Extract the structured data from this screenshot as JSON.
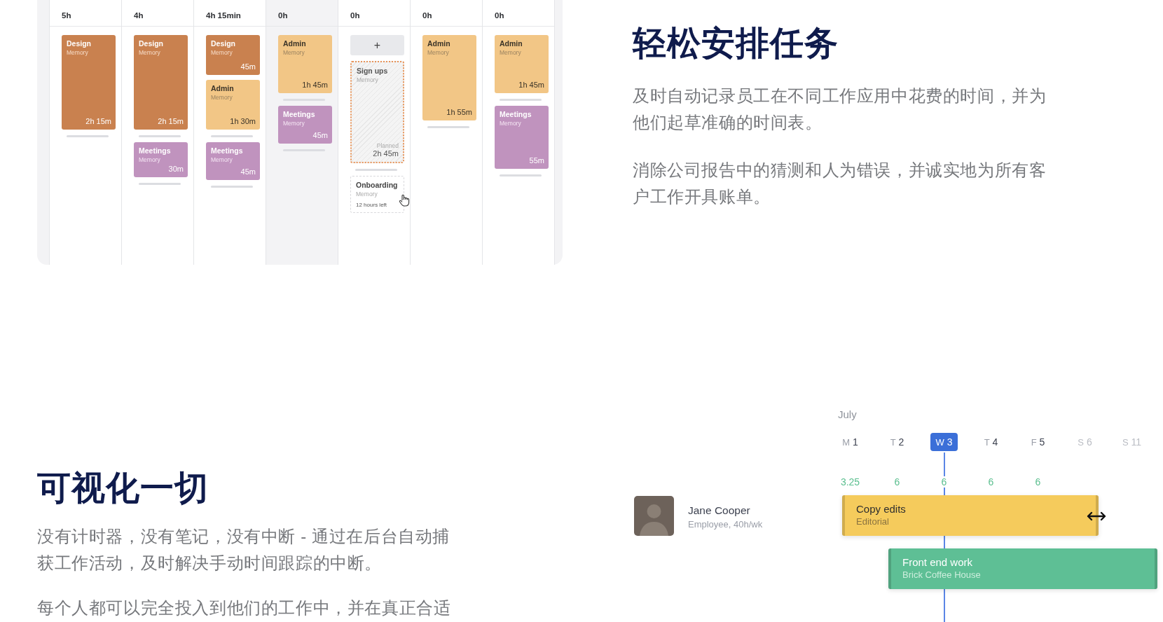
{
  "calendar": {
    "columns": [
      {
        "total": "5h",
        "current": false,
        "groups": [
          {
            "items": [
              {
                "kind": "design",
                "title": "Design",
                "subtitle": "Memory",
                "duration": "2h 15m"
              }
            ]
          }
        ]
      },
      {
        "total": "4h",
        "current": false,
        "groups": [
          {
            "items": [
              {
                "kind": "design",
                "title": "Design",
                "subtitle": "Memory",
                "duration": "2h 15m"
              }
            ]
          },
          {
            "items": [
              {
                "kind": "meetings",
                "title": "Meetings",
                "subtitle": "Memory",
                "duration": "30m"
              }
            ]
          }
        ]
      },
      {
        "total": "4h 15min",
        "current": false,
        "groups": [
          {
            "items": [
              {
                "kind": "design",
                "title": "Design",
                "subtitle": "Memory",
                "duration": "45m"
              },
              {
                "kind": "admin",
                "title": "Admin",
                "subtitle": "Memory",
                "duration": "1h 30m"
              }
            ]
          },
          {
            "items": [
              {
                "kind": "meetings",
                "title": "Meetings",
                "subtitle": "Memory",
                "duration": "45m"
              }
            ]
          }
        ]
      },
      {
        "total": "0h",
        "current": true,
        "groups": [
          {
            "items": [
              {
                "kind": "admin",
                "title": "Admin",
                "subtitle": "Memory",
                "duration": "1h 45m"
              }
            ]
          },
          {
            "items": [
              {
                "kind": "meetings",
                "title": "Meetings",
                "subtitle": "Memory",
                "duration": "45m"
              }
            ]
          }
        ]
      },
      {
        "total": "0h",
        "current": false,
        "groups": [
          {
            "items": [
              {
                "kind": "add",
                "title": "+"
              }
            ]
          },
          {
            "items": [
              {
                "kind": "planned",
                "title": "Sign ups",
                "subtitle": "Memory",
                "note": "Planned",
                "duration": "2h 45m"
              }
            ]
          },
          {
            "items": [
              {
                "kind": "unplanned",
                "title": "Onboarding",
                "subtitle": "Memory",
                "note": "12 hours left"
              }
            ]
          }
        ]
      },
      {
        "total": "0h",
        "current": false,
        "groups": [
          {
            "items": [
              {
                "kind": "admin",
                "title": "Admin",
                "subtitle": "Memory",
                "duration": "1h 55m"
              }
            ]
          }
        ]
      },
      {
        "total": "0h",
        "current": false,
        "groups": [
          {
            "items": [
              {
                "kind": "admin",
                "title": "Admin",
                "subtitle": "Memory",
                "duration": "1h 45m"
              }
            ]
          },
          {
            "items": [
              {
                "kind": "meetings",
                "title": "Meetings",
                "subtitle": "Memory",
                "duration": "55m"
              }
            ]
          }
        ]
      }
    ]
  },
  "schedule_section": {
    "heading": "轻松安排任务",
    "paragraphs": [
      "及时自动记录员工在不同工作应用中花费的时间，并为他们起草准确的时间表。",
      "消除公司报告中的猜测和人为错误，并诚实地为所有客户工作开具账单。"
    ]
  },
  "visualize_section": {
    "heading": "可视化一切",
    "paragraphs": [
      "没有计时器，没有笔记，没有中断 - 通过在后台自动捕获工作活动，及时解决手动时间跟踪的中断。",
      "每个人都可以完全投入到他们的工作中，并在真正合适"
    ]
  },
  "timeline": {
    "month": "July",
    "days": [
      {
        "letter": "M",
        "number": "1",
        "selected": false,
        "weekend": false,
        "hours": "3.25"
      },
      {
        "letter": "T",
        "number": "2",
        "selected": false,
        "weekend": false,
        "hours": "6"
      },
      {
        "letter": "W",
        "number": "3",
        "selected": true,
        "weekend": false,
        "hours": "6"
      },
      {
        "letter": "T",
        "number": "4",
        "selected": false,
        "weekend": false,
        "hours": "6"
      },
      {
        "letter": "F",
        "number": "5",
        "selected": false,
        "weekend": false,
        "hours": "6"
      },
      {
        "letter": "S",
        "number": "6",
        "selected": false,
        "weekend": true
      },
      {
        "letter": "S",
        "number": "11",
        "selected": false,
        "weekend": true
      }
    ],
    "person": {
      "name": "Jane Cooper",
      "role": "Employee, 40h/wk"
    },
    "tasks": [
      {
        "title": "Copy edits",
        "client": "Editorial",
        "color": "#f5cb5c"
      },
      {
        "title": "Front end work",
        "client": "Brick Coffee House",
        "color": "#5ebf95"
      }
    ]
  }
}
